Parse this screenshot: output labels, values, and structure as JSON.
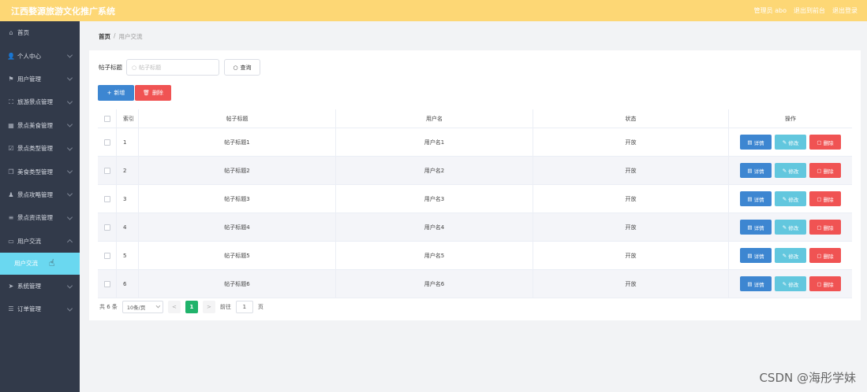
{
  "header": {
    "title": "江西婺源旅游文化推广系统",
    "admin_label": "管理员 abo",
    "back_label": "退出到前台",
    "logout_label": "退出登录"
  },
  "sidebar": {
    "items": [
      {
        "label": "首页",
        "icon": "home-icon",
        "glyph": "⌂",
        "chevron": false
      },
      {
        "label": "个人中心",
        "icon": "user-icon",
        "glyph": "👤",
        "chevron": true
      },
      {
        "label": "用户管理",
        "icon": "flag-icon",
        "glyph": "⚑",
        "chevron": true
      },
      {
        "label": "旅游景点管理",
        "icon": "frame-icon",
        "glyph": "⛶",
        "chevron": true
      },
      {
        "label": "景点美食管理",
        "icon": "grid-icon",
        "glyph": "▦",
        "chevron": true
      },
      {
        "label": "景点类型管理",
        "icon": "check-square-icon",
        "glyph": "☑",
        "chevron": true
      },
      {
        "label": "美食类型管理",
        "icon": "copy-icon",
        "glyph": "❐",
        "chevron": true
      },
      {
        "label": "景点攻略管理",
        "icon": "person-icon",
        "glyph": "♟",
        "chevron": true
      },
      {
        "label": "景点资讯管理",
        "icon": "sliders-icon",
        "glyph": "≡",
        "chevron": true
      },
      {
        "label": "用户交流",
        "icon": "chat-icon",
        "glyph": "▭",
        "chevron": true,
        "expanded": true
      }
    ],
    "sub_active": "用户交流",
    "items_after": [
      {
        "label": "系统管理",
        "icon": "send-icon",
        "glyph": "➤",
        "chevron": true
      },
      {
        "label": "订单管理",
        "icon": "list-icon",
        "glyph": "☰",
        "chevron": true
      }
    ]
  },
  "breadcrumb": {
    "home": "首页",
    "separator": "/",
    "current": "用户交流"
  },
  "search": {
    "label": "帖子标题",
    "placeholder": "帖子标题",
    "button": "查询"
  },
  "toolbar": {
    "add_label": "新增",
    "delete_label": "删除"
  },
  "table": {
    "columns": [
      "索引",
      "帖子标题",
      "用户名",
      "状态",
      "操作"
    ],
    "rows": [
      {
        "index": "1",
        "title": "帖子标题1",
        "user": "用户名1",
        "status": "开放"
      },
      {
        "index": "2",
        "title": "帖子标题2",
        "user": "用户名2",
        "status": "开放"
      },
      {
        "index": "3",
        "title": "帖子标题3",
        "user": "用户名3",
        "status": "开放"
      },
      {
        "index": "4",
        "title": "帖子标题4",
        "user": "用户名4",
        "status": "开放"
      },
      {
        "index": "5",
        "title": "帖子标题5",
        "user": "用户名5",
        "status": "开放"
      },
      {
        "index": "6",
        "title": "帖子标题6",
        "user": "用户名6",
        "status": "开放"
      }
    ],
    "ops": {
      "detail": "详情",
      "edit": "修改",
      "delete": "删除"
    }
  },
  "pager": {
    "total": "共 6 条",
    "page_size": "10条/页",
    "prev": "<",
    "current": "1",
    "next": ">",
    "goto_label": "前往",
    "goto_value": "1",
    "page_unit": "页"
  },
  "watermark": "CSDN @海彤学妹",
  "colors": {
    "header": "#fdd775",
    "sidebar": "#323a4a",
    "active_sub": "#6ad8f0",
    "primary": "#3d86d1",
    "danger": "#f05353",
    "info": "#62c7de",
    "pager_active": "#20b36b"
  }
}
